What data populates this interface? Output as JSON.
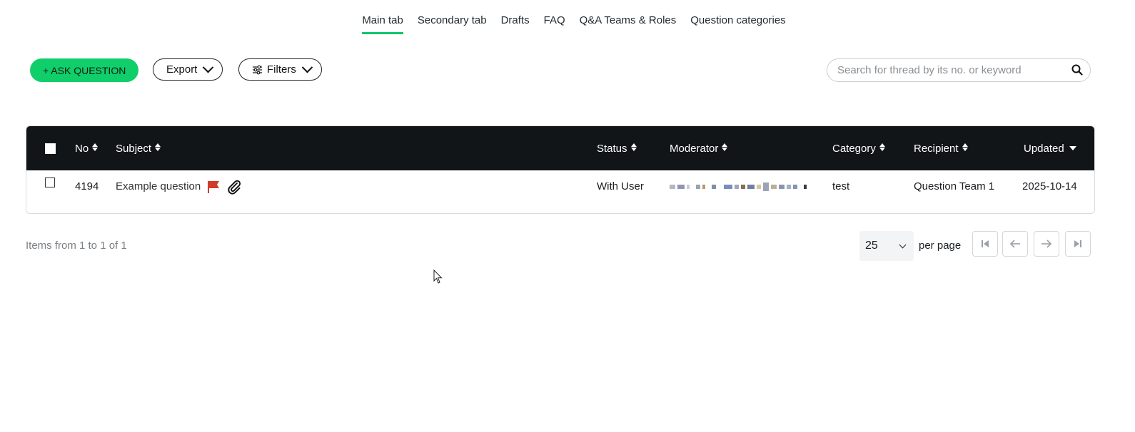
{
  "tabs": [
    {
      "label": "Main tab",
      "active": true
    },
    {
      "label": "Secondary tab",
      "active": false
    },
    {
      "label": "Drafts",
      "active": false
    },
    {
      "label": "FAQ",
      "active": false
    },
    {
      "label": "Q&A Teams & Roles",
      "active": false
    },
    {
      "label": "Question categories",
      "active": false
    }
  ],
  "toolbar": {
    "ask_label": "+ ASK QUESTION",
    "export_label": "Export",
    "filters_label": "Filters",
    "search_placeholder": "Search for thread by its no. or keyword"
  },
  "table": {
    "headers": {
      "no": "No",
      "subject": "Subject",
      "status": "Status",
      "moderator": "Moderator",
      "category": "Category",
      "recipient": "Recipient",
      "updated": "Updated"
    },
    "rows": [
      {
        "no": "4194",
        "subject": "Example question",
        "flagged": true,
        "has_attachment": true,
        "status": "With User",
        "moderator_redacted": true,
        "category": "test",
        "recipient": "Question Team 1",
        "updated": "2025-10-14"
      }
    ]
  },
  "footer": {
    "items_info": "Items from 1 to 1 of 1",
    "per_page_value": "25",
    "per_page_label": "per page"
  },
  "colors": {
    "accent": "#10cf6a",
    "table_header_bg": "#111518",
    "flag": "#d23a2a"
  }
}
